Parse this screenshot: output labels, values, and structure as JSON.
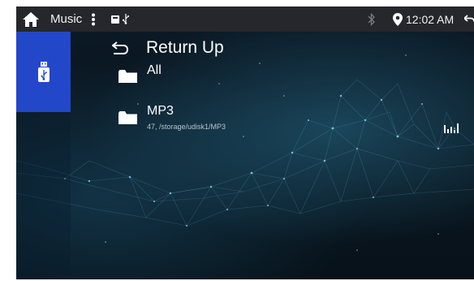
{
  "status_bar": {
    "app_title": "Music",
    "time": "12:02 AM",
    "icons": [
      "home-icon",
      "more-vert-icon",
      "sd-card-icon",
      "usb-icon",
      "bluetooth-icon",
      "location-icon",
      "back-icon"
    ]
  },
  "sidebar": {
    "items": [
      {
        "icon": "usb-drive-icon",
        "active": true
      }
    ],
    "accent": "#2347c9"
  },
  "list": {
    "return_up": {
      "label": "Return Up",
      "icon": "return-icon"
    },
    "items": [
      {
        "name": "All",
        "subtitle": "",
        "icon": "folder-icon"
      },
      {
        "name": "MP3",
        "subtitle": "47, /storage/udisk1/MP3",
        "icon": "folder-icon"
      }
    ]
  },
  "now_playing_indicator": {
    "icon": "equalizer-icon"
  }
}
